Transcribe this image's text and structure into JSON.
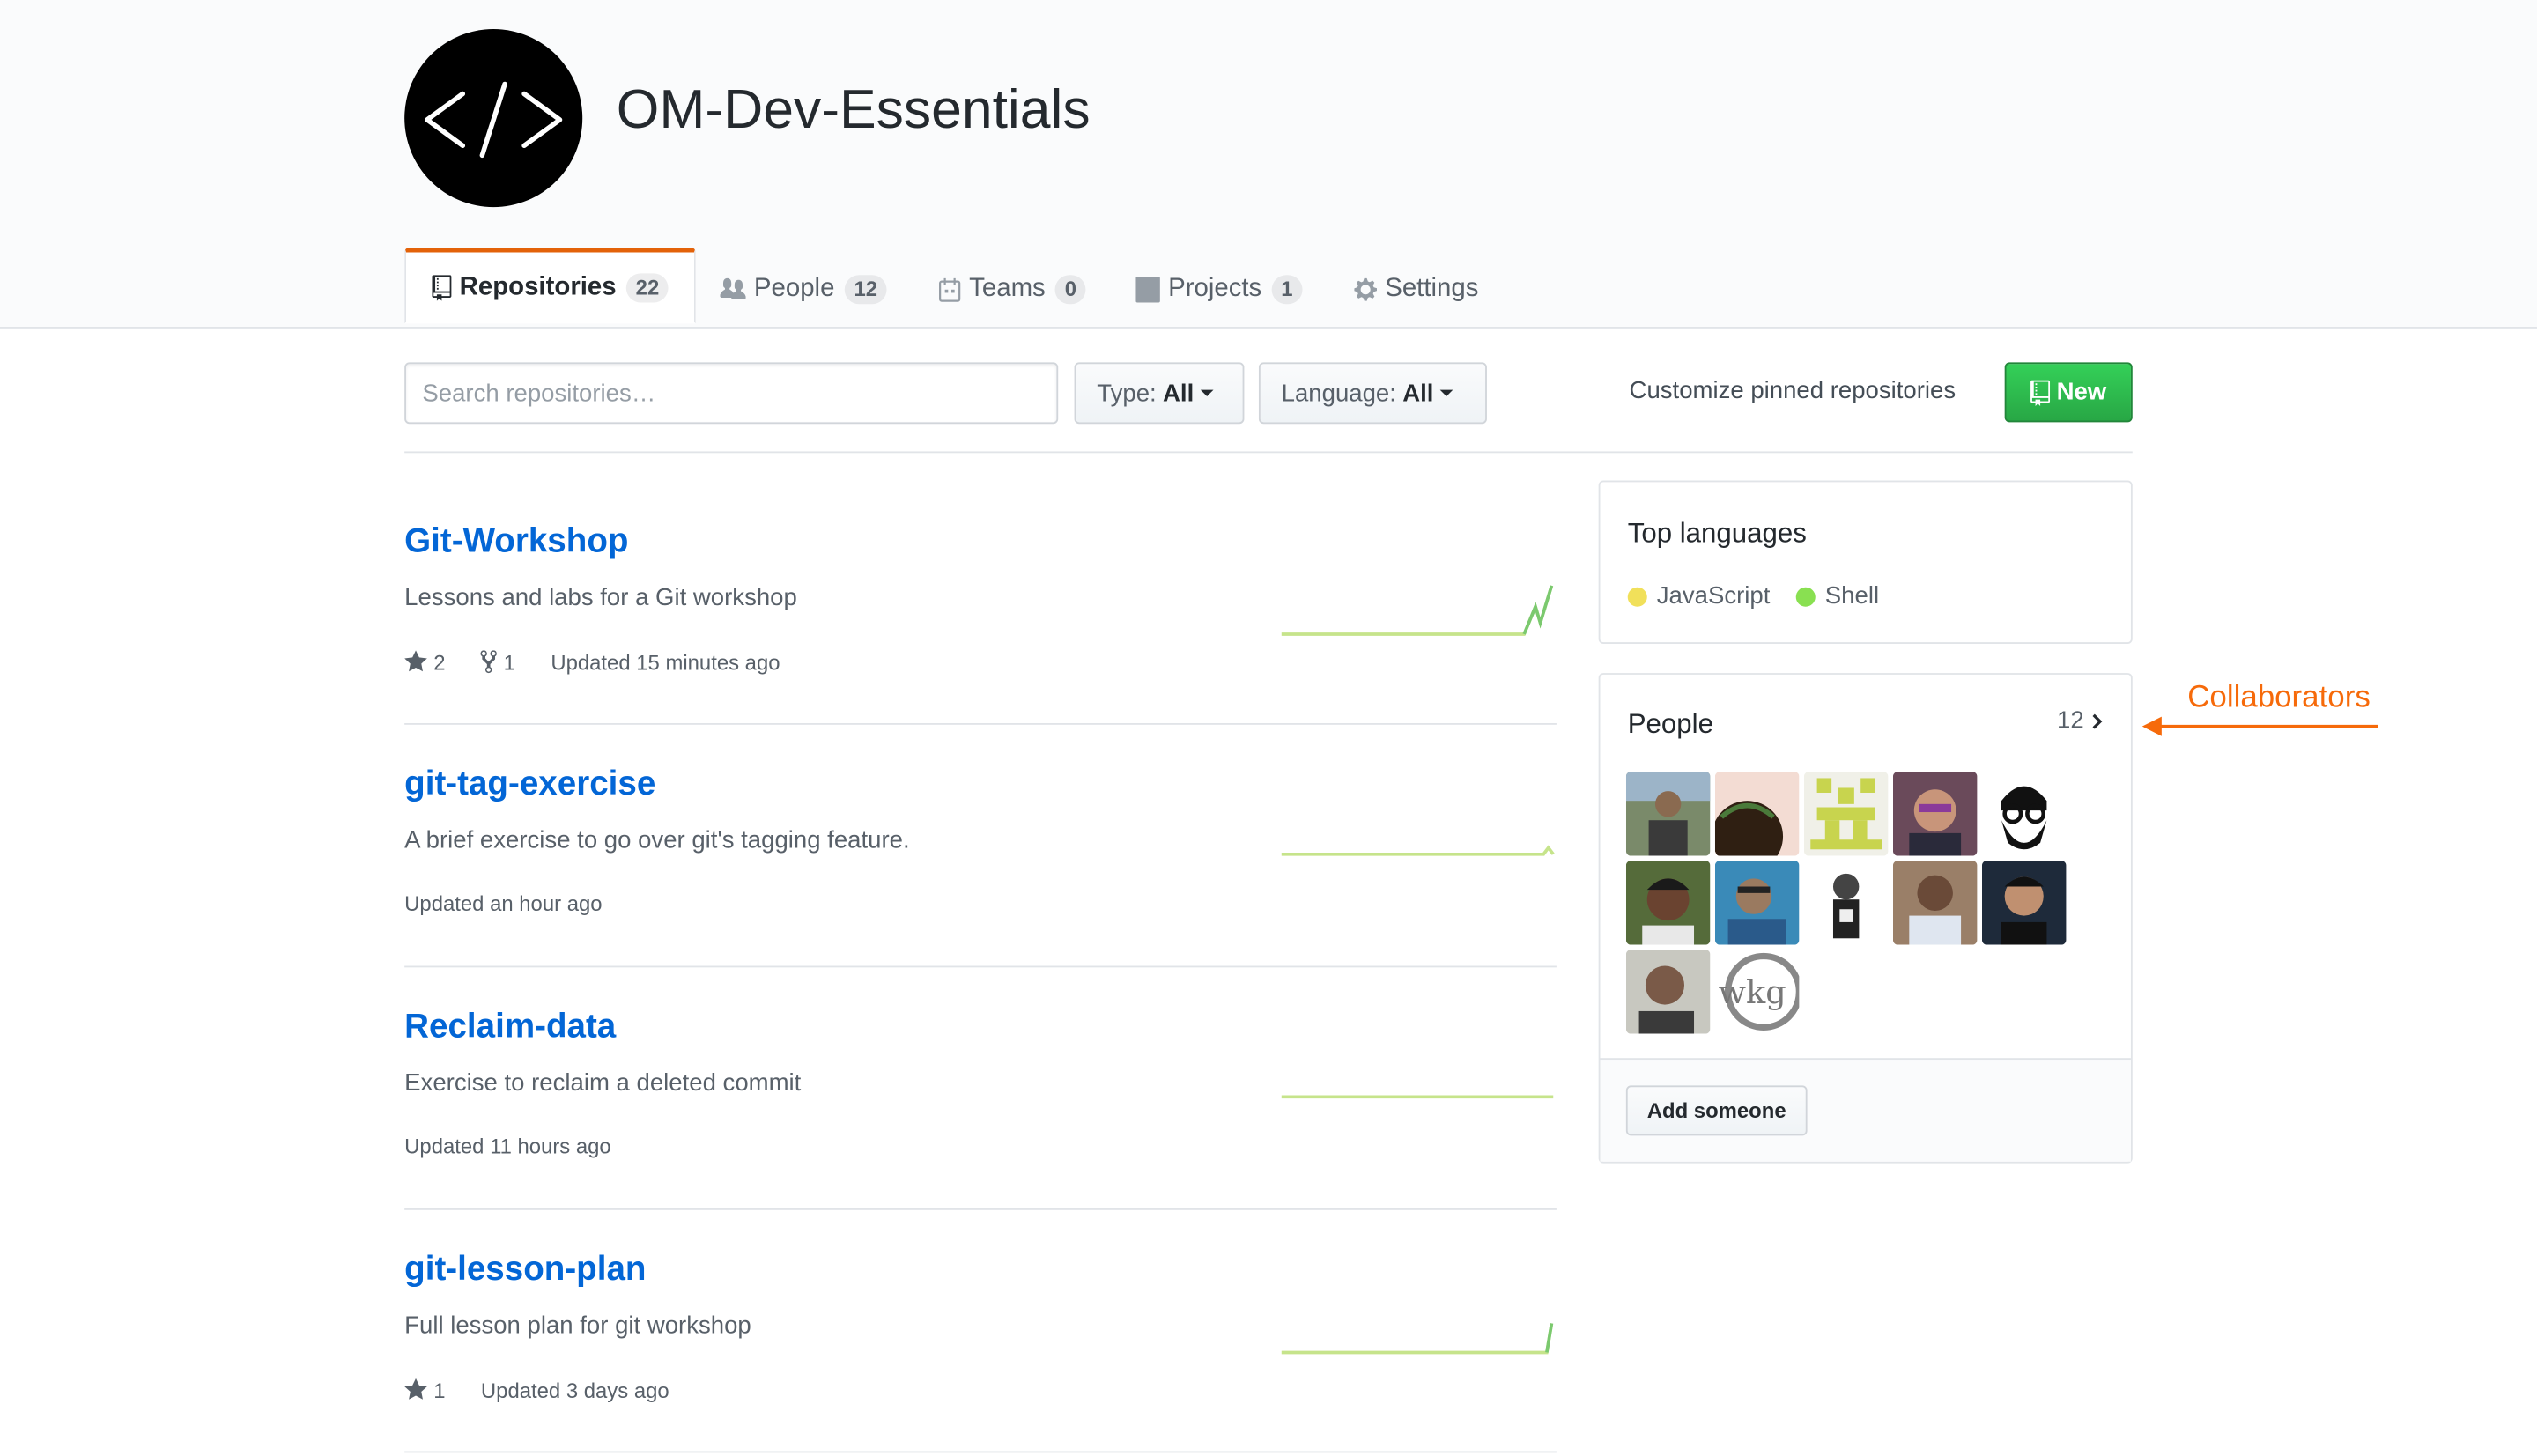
{
  "org": {
    "name": "OM-Dev-Essentials",
    "avatar_glyph": "</>"
  },
  "tabs": [
    {
      "label": "Repositories",
      "count": "22",
      "icon": "repo-icon",
      "selected": true
    },
    {
      "label": "People",
      "count": "12",
      "icon": "people-icon",
      "selected": false
    },
    {
      "label": "Teams",
      "count": "0",
      "icon": "teams-icon",
      "selected": false
    },
    {
      "label": "Projects",
      "count": "1",
      "icon": "project-icon",
      "selected": false
    },
    {
      "label": "Settings",
      "count": null,
      "icon": "gear-icon",
      "selected": false
    }
  ],
  "filters": {
    "search_placeholder": "Search repositories…",
    "type_label": "Type:",
    "type_value": "All",
    "language_label": "Language:",
    "language_value": "All",
    "customize_text": "Customize pinned repositories",
    "new_label": "New"
  },
  "repos": [
    {
      "name": "Git-Workshop",
      "description": "Lessons and labs for a Git workshop",
      "stars": "2",
      "forks": "1",
      "updated": "Updated 15 minutes ago"
    },
    {
      "name": "git-tag-exercise",
      "description": "A brief exercise to go over git's tagging feature.",
      "stars": null,
      "forks": null,
      "updated": "Updated an hour ago"
    },
    {
      "name": "Reclaim-data",
      "description": "Exercise to reclaim a deleted commit",
      "stars": null,
      "forks": null,
      "updated": "Updated 11 hours ago"
    },
    {
      "name": "git-lesson-plan",
      "description": "Full lesson plan for git workshop",
      "stars": "1",
      "forks": null,
      "updated": "Updated 3 days ago"
    }
  ],
  "sidebar": {
    "top_languages": {
      "title": "Top languages",
      "languages": [
        {
          "name": "JavaScript",
          "color": "#f1e05a"
        },
        {
          "name": "Shell",
          "color": "#89e051"
        }
      ]
    },
    "people": {
      "title": "People",
      "count": "12",
      "add_label": "Add someone"
    }
  },
  "annotation": {
    "label": "Collaborators",
    "color": "#f66a0a"
  },
  "colors": {
    "link": "#0366d6",
    "tab_accent": "#e36209",
    "new_button": "#28a745"
  }
}
